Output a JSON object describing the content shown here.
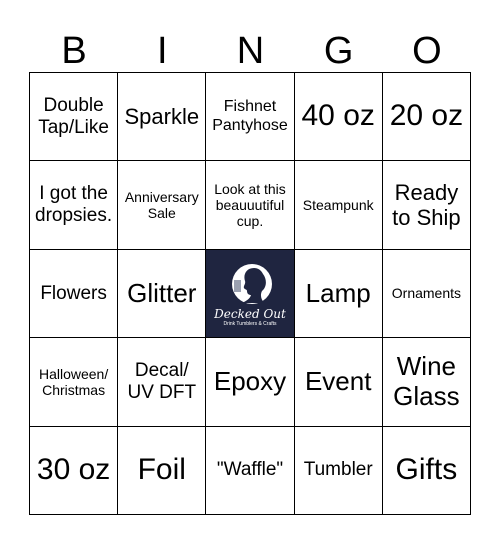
{
  "header": [
    "B",
    "I",
    "N",
    "G",
    "O"
  ],
  "cells": [
    [
      "Double Tap/Like",
      "Sparkle",
      "Fishnet Pantyhose",
      "40 oz",
      "20 oz"
    ],
    [
      "I got the dropsies.",
      "Anniversary Sale",
      "Look at this beauuutiful cup.",
      "Steampunk",
      "Ready to Ship"
    ],
    [
      "Flowers",
      "Glitter",
      "",
      "Lamp",
      "Ornaments"
    ],
    [
      "Halloween/ Christmas",
      "Decal/ UV DFT",
      "Epoxy",
      "Event",
      "Wine Glass"
    ],
    [
      "30 oz",
      "Foil",
      "\"Waffle\"",
      "Tumbler",
      "Gifts"
    ]
  ],
  "free_space": {
    "logo_text": "Decked Out",
    "logo_subtext": "Drink Tumblers & Crafts",
    "background": "#1f2540"
  }
}
